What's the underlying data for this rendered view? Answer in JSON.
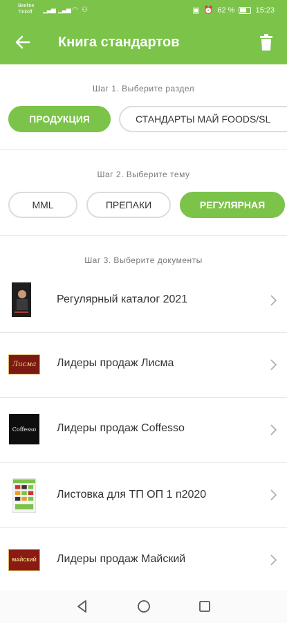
{
  "status": {
    "carrier1": "Beeline",
    "carrier2": "Tinkoff",
    "battery": "62 %",
    "time": "15:23"
  },
  "appbar": {
    "title": "Книга стандартов"
  },
  "step1": {
    "label": "Шаг 1. Выберите раздел",
    "chips": [
      "ПРОДУКЦИЯ",
      "СТАНДАРТЫ МАЙ FOODS/SL"
    ]
  },
  "step2": {
    "label": "Шаг 2. Выберите тему",
    "chips": [
      "MML",
      "ПРЕПАКИ",
      "РЕГУЛЯРНАЯ"
    ]
  },
  "step3": {
    "label": "Шаг 3. Выберите документы",
    "documents": [
      {
        "title": "Регулярный каталог 2021",
        "thumb_text": ""
      },
      {
        "title": "Лидеры продаж Лисма",
        "thumb_text": "Лисма"
      },
      {
        "title": "Лидеры продаж Coffesso",
        "thumb_text": "Coffesso"
      },
      {
        "title": "Листовка для ТП ОП 1 п2020",
        "thumb_text": ""
      },
      {
        "title": "Лидеры продаж Майский",
        "thumb_text": "МАЙСКИЙ"
      }
    ]
  },
  "colors": {
    "accent": "#7cc349",
    "chip_border": "#dcdcdc"
  },
  "icons": {
    "back": "arrow-left-icon",
    "trash": "trash-icon",
    "chevron": "chevron-right-icon",
    "nav": [
      "back-triangle-icon",
      "home-circle-icon",
      "recents-square-icon"
    ]
  }
}
